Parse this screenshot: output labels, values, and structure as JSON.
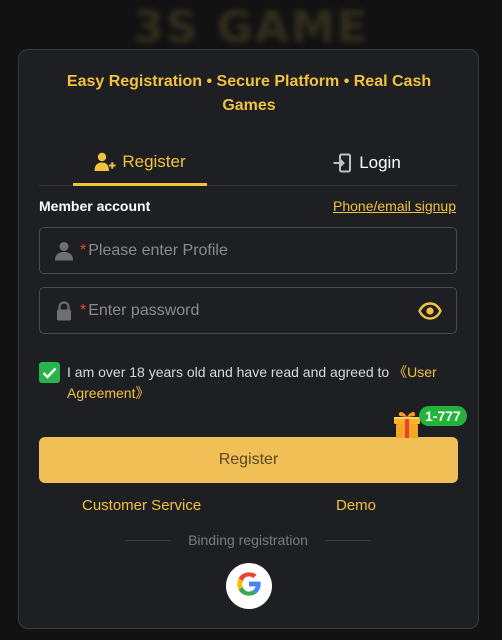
{
  "background": {
    "brand_text": "3S GAME"
  },
  "tagline": "Easy Registration • Secure Platform • Real Cash Games",
  "tabs": {
    "register": {
      "label": "Register",
      "icon": "add-user-icon"
    },
    "login": {
      "label": "Login",
      "icon": "login-icon"
    }
  },
  "form": {
    "member_account_label": "Member account",
    "alt_signup_link": "Phone/email signup",
    "profile": {
      "required_mark": "*",
      "placeholder": "Please enter Profile",
      "icon": "user-icon"
    },
    "password": {
      "required_mark": "*",
      "placeholder": "Enter password",
      "icon": "lock-icon",
      "toggle_icon": "eye-icon"
    },
    "agreement": {
      "checked": true,
      "text": "I am over 18 years old and have read and agreed to ",
      "link": "《User Agreement》"
    },
    "register_button": "Register",
    "promo_badge": "1-777"
  },
  "footer": {
    "customer_service": "Customer Service",
    "demo": "Demo",
    "binding_label": "Binding registration",
    "google_icon": "google-icon"
  },
  "colors": {
    "accent": "#f2c23e",
    "button": "#f0bf55",
    "checkbox": "#27b44b",
    "badge": "#22b33a",
    "modal_bg": "#1e1f22"
  }
}
